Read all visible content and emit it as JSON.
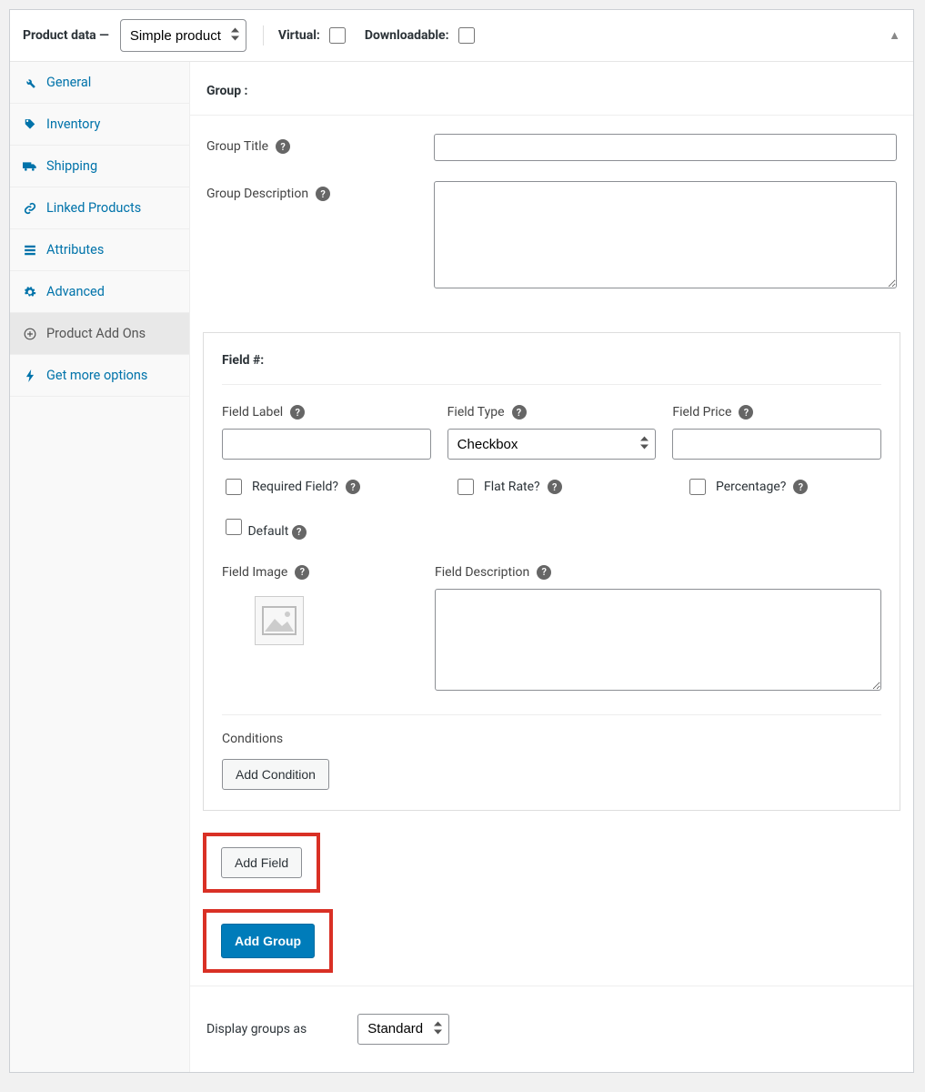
{
  "header": {
    "title": "Product data —",
    "productTypeOptions": [
      "Simple product"
    ],
    "productTypeSelected": "Simple product",
    "virtualLabel": "Virtual:",
    "downloadableLabel": "Downloadable:"
  },
  "sidebar": {
    "items": [
      {
        "icon": "wrench",
        "label": "General"
      },
      {
        "icon": "tag",
        "label": "Inventory"
      },
      {
        "icon": "truck",
        "label": "Shipping"
      },
      {
        "icon": "link",
        "label": "Linked Products"
      },
      {
        "icon": "list",
        "label": "Attributes"
      },
      {
        "icon": "gear",
        "label": "Advanced"
      },
      {
        "icon": "plus-circle",
        "label": "Product Add Ons",
        "active": true
      },
      {
        "icon": "bolt",
        "label": "Get more options"
      }
    ]
  },
  "group": {
    "sectionTitle": "Group :",
    "titleLabel": "Group Title",
    "titleValue": "",
    "descLabel": "Group Description",
    "descValue": ""
  },
  "field": {
    "sectionTitle": "Field #:",
    "labelLabel": "Field Label",
    "labelValue": "",
    "typeLabel": "Field Type",
    "typeSelected": "Checkbox",
    "priceLabel": "Field Price",
    "priceValue": "",
    "requiredLabel": "Required Field?",
    "flatLabel": "Flat Rate?",
    "percentageLabel": "Percentage?",
    "defaultLabel": "Default",
    "imageLabel": "Field Image",
    "descLabel": "Field Description",
    "descValue": "",
    "conditionsLabel": "Conditions",
    "addConditionBtn": "Add Condition"
  },
  "actions": {
    "addField": "Add Field",
    "addGroup": "Add Group"
  },
  "display": {
    "label": "Display groups as",
    "selected": "Standard"
  }
}
